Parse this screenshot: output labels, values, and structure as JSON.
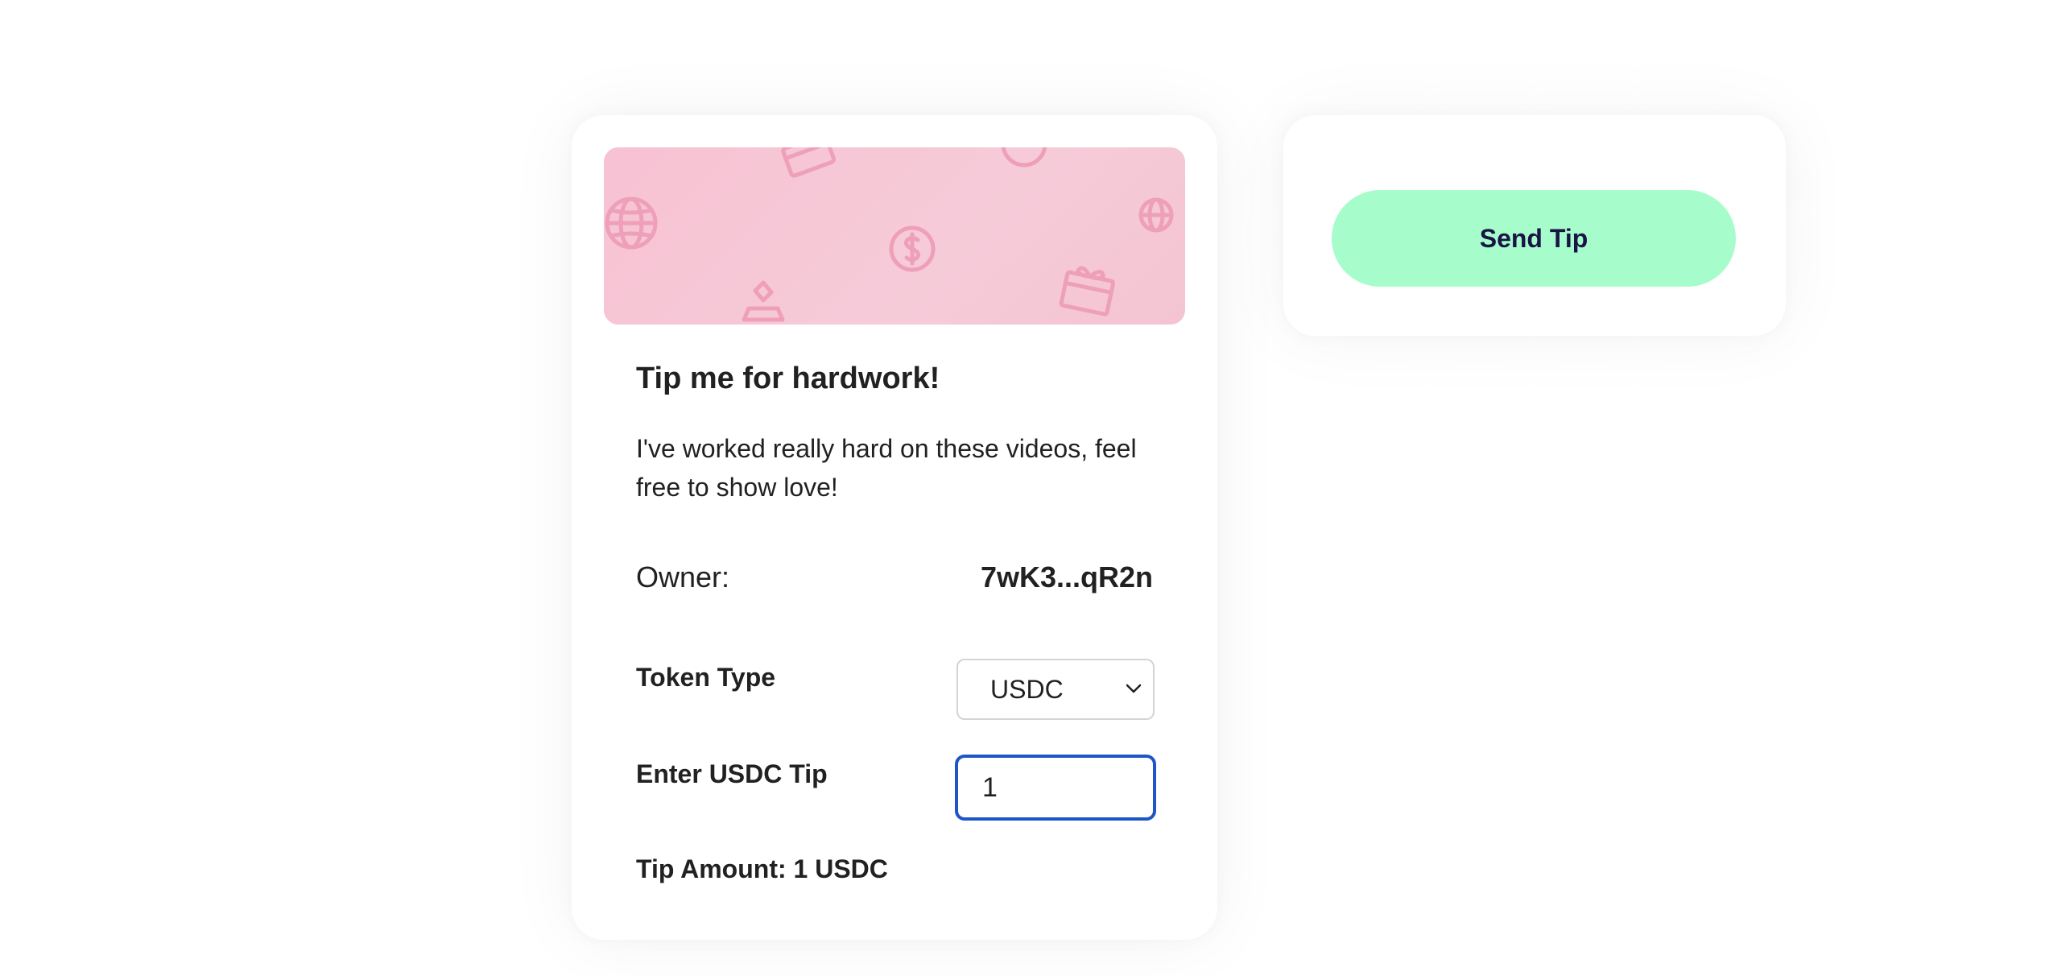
{
  "tip_card": {
    "title": "Tip me for hardwork!",
    "description": "I've worked really hard on these videos, feel free to show love!",
    "owner_label": "Owner:",
    "owner_value": "7wK3...qR2n",
    "token_type_label": "Token Type",
    "token_type_selected": "USDC",
    "amount_label": "Enter USDC Tip",
    "amount_value": "1",
    "tip_amount_text": "Tip Amount: 1 USDC",
    "banner_icons": [
      "globe-icon",
      "wallet-icon",
      "coin-icon",
      "diamond-icon",
      "gift-icon"
    ]
  },
  "actions": {
    "send_tip_label": "Send Tip"
  },
  "colors": {
    "banner_pink": "#f7c6d4",
    "send_button_bg": "#a6fdcb",
    "send_button_text": "#1a1446",
    "input_focus_border": "#1e56c8"
  }
}
